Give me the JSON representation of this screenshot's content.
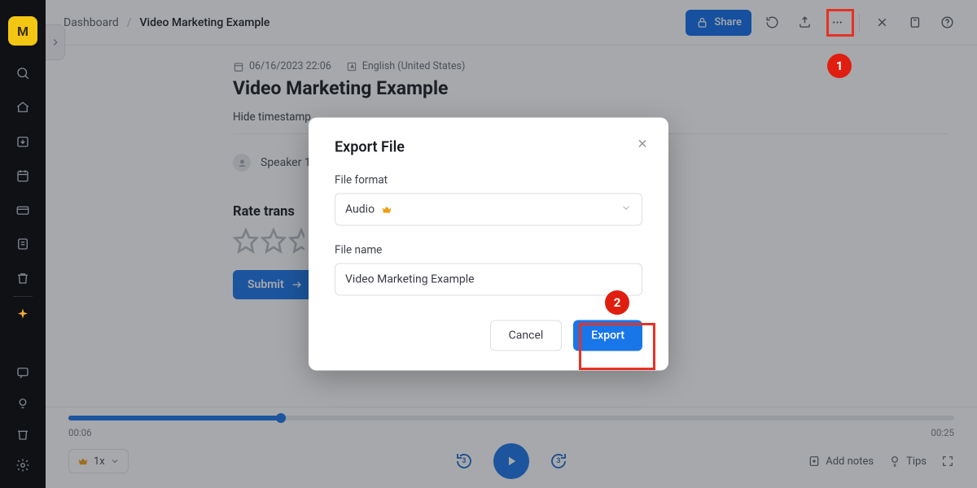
{
  "sidebar": {
    "avatar_letter": "M"
  },
  "breadcrumb": {
    "root": "Dashboard",
    "separator": "/",
    "current": "Video Marketing Example"
  },
  "topbar": {
    "share_label": "Share"
  },
  "meta": {
    "date": "06/16/2023 22:06",
    "language": "English (United States)"
  },
  "page": {
    "title": "Video Marketing Example",
    "hide_timestamps": "Hide timestamp"
  },
  "speaker": {
    "name": "Speaker 1"
  },
  "rating": {
    "heading": "Rate trans",
    "submit": "Submit"
  },
  "player": {
    "time_current": "00:06",
    "time_total": "00:25",
    "progress_pct": 24,
    "speed_label": "1x",
    "skip_seconds": "3",
    "add_notes": "Add notes",
    "tips": "Tips"
  },
  "modal": {
    "title": "Export File",
    "file_format_label": "File format",
    "file_format_value": "Audio",
    "file_name_label": "File name",
    "file_name_value": "Video Marketing Example",
    "cancel": "Cancel",
    "export": "Export"
  },
  "annotations": {
    "one": "1",
    "two": "2"
  }
}
